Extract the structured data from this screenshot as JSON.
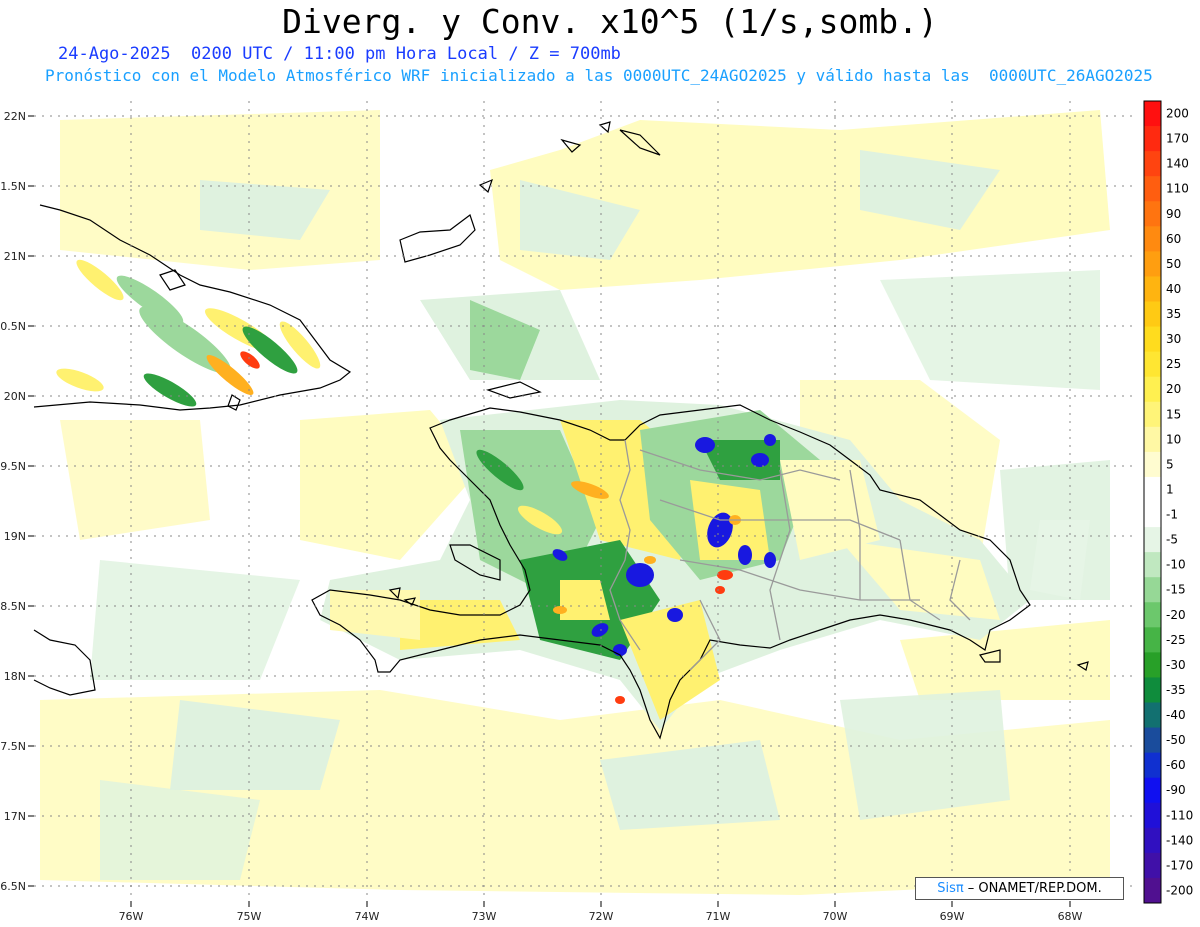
{
  "header": {
    "title": "Diverg. y Conv. x10^5 (1/s,somb.)",
    "valid_line": "24-Ago-2025  0200 UTC / 11:00 pm Hora Local / Z = 700mb",
    "forecast_line": "Pronóstico con el Modelo Atmosférico WRF inicializado a las 0000UTC_24AGO2025 y válido hasta las  0000UTC_26AGO2025"
  },
  "axes": {
    "lat_labels": [
      "22N",
      "1.5N",
      "21N",
      "0.5N",
      "20N",
      "9.5N",
      "19N",
      "8.5N",
      "18N",
      "7.5N",
      "17N",
      "6.5N"
    ],
    "lon_labels": [
      "76W",
      "75W",
      "74W",
      "73W",
      "72W",
      "71W",
      "70W",
      "69W",
      "68W"
    ]
  },
  "colorbar": {
    "labels": [
      "200",
      "170",
      "140",
      "110",
      "90",
      "60",
      "50",
      "40",
      "35",
      "30",
      "25",
      "20",
      "15",
      "10",
      "5",
      "1",
      "-1",
      "-5",
      "-10",
      "-15",
      "-20",
      "-25",
      "-30",
      "-35",
      "-40",
      "-50",
      "-60",
      "-90",
      "-110",
      "-140",
      "-170",
      "-200"
    ],
    "colors": [
      "#ff1010",
      "#ff2a10",
      "#ff4410",
      "#ff5e10",
      "#ff7410",
      "#ff8a10",
      "#ff9e10",
      "#ffb410",
      "#ffca14",
      "#ffdc1e",
      "#ffe632",
      "#fff050",
      "#fff478",
      "#fff8a4",
      "#fffcd0",
      "#ffffff",
      "#ffffff",
      "#e6f5e6",
      "#c0e8c0",
      "#96d896",
      "#6cc86c",
      "#46b446",
      "#28a028",
      "#0f8c3c",
      "#127070",
      "#1a4c9c",
      "#1030d0",
      "#1010f0",
      "#2010d8",
      "#3010c0",
      "#4010a8",
      "#501090"
    ]
  },
  "map": {
    "field_colors": {
      "light_yellow": "#fffcc0",
      "yellow": "#fff170",
      "orange": "#ffb020",
      "red": "#ff3c10",
      "light_green": "#dff2df",
      "green": "#9cd89c",
      "dark_green": "#2fa040",
      "blue": "#1818e0"
    },
    "coast_color": "#000000",
    "border_color": "#9a9a9a",
    "grid_color": "#888888"
  },
  "credit": {
    "brand": "Sisπ",
    "rest": "–  ONAMET/REP.DOM."
  }
}
